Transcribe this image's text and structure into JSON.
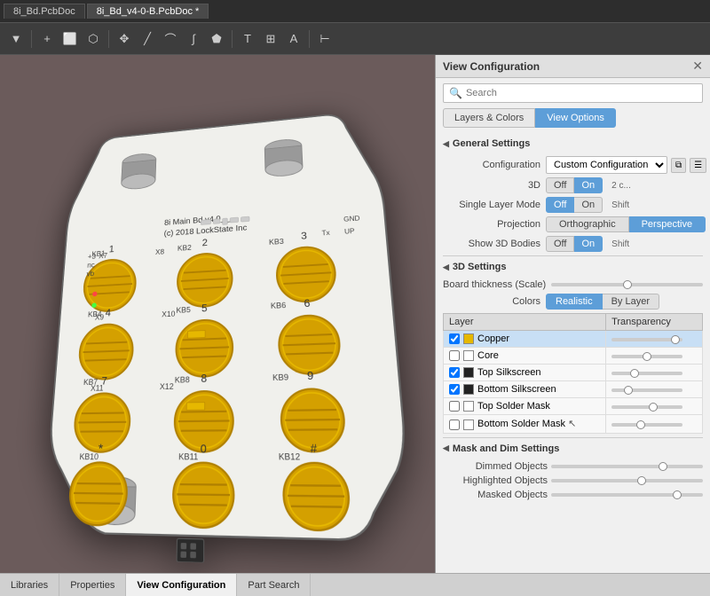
{
  "tabs": [
    {
      "label": "8i_Bd.PcbDoc",
      "active": false
    },
    {
      "label": "8i_Bd_v4-0-B.PcbDoc",
      "active": true,
      "modified": true
    }
  ],
  "toolbar": {
    "tools": [
      "filter",
      "add",
      "rect-select",
      "lasso-select",
      "move",
      "wire",
      "arc",
      "bezier",
      "polygon",
      "text-place",
      "component",
      "A",
      "measure"
    ]
  },
  "panel": {
    "title": "View Configuration",
    "search_placeholder": "Search",
    "tabs": [
      {
        "label": "Layers & Colors",
        "active": false
      },
      {
        "label": "View Options",
        "active": true
      }
    ],
    "general_settings": {
      "header": "General Settings",
      "configuration_label": "Configuration",
      "configuration_value": "Custom Configuration",
      "three_d_label": "3D",
      "three_d_off": "Off",
      "three_d_on": "On",
      "three_d_active": "on",
      "single_layer_label": "Single Layer Mode",
      "single_layer_off": "Off",
      "single_layer_on": "On",
      "single_layer_active": "off",
      "single_layer_shortcut": "Shift",
      "projection_label": "Projection",
      "projection_ortho": "Orthographic",
      "projection_persp": "Perspective",
      "projection_active": "perspective",
      "show_3d_label": "Show 3D Bodies",
      "show_3d_off": "Off",
      "show_3d_on": "On",
      "show_3d_active": "on",
      "show_3d_shortcut": "Shift"
    },
    "settings_3d": {
      "header": "3D Settings",
      "board_thickness_label": "Board thickness (Scale)",
      "colors_label": "Colors",
      "colors_realistic": "Realistic",
      "colors_by_layer": "By Layer",
      "colors_active": "realistic",
      "layers": {
        "col_layer": "Layer",
        "col_transparency": "Transparency",
        "rows": [
          {
            "name": "Copper",
            "color": "#e6b800",
            "checked": true,
            "selected": true,
            "transparency": 95
          },
          {
            "name": "Core",
            "color": "#ffffff",
            "checked": false,
            "selected": false,
            "transparency": 50
          },
          {
            "name": "Top Silkscreen",
            "color": "#222222",
            "checked": true,
            "selected": false,
            "transparency": 30
          },
          {
            "name": "Bottom Silkscreen",
            "color": "#222222",
            "checked": true,
            "selected": false,
            "transparency": 20
          },
          {
            "name": "Top Solder Mask",
            "color": "#ffffff",
            "checked": false,
            "selected": false,
            "transparency": 60
          },
          {
            "name": "Bottom Solder Mask",
            "color": "#ffffff",
            "checked": false,
            "selected": false,
            "transparency": 40
          }
        ]
      }
    },
    "mask_dim": {
      "header": "Mask and Dim Settings",
      "dimmed_label": "Dimmed Objects",
      "dimmed_value": 75,
      "highlighted_label": "Highlighted Objects",
      "highlighted_value": 60,
      "masked_label": "Masked Objects",
      "masked_value": 85
    }
  },
  "bottom_tabs": [
    {
      "label": "Libraries"
    },
    {
      "label": "Properties"
    },
    {
      "label": "View Configuration",
      "active": true
    },
    {
      "label": "Part Search"
    }
  ]
}
